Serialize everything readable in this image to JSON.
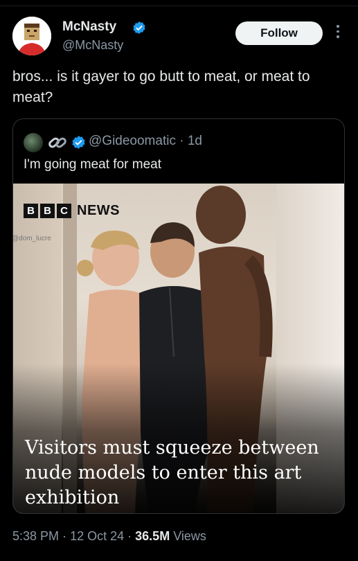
{
  "author": {
    "name": "McNasty",
    "handle": "@McNasty",
    "follow_label": "Follow",
    "verified_color": "#1d9bf0"
  },
  "tweet": {
    "text": "bros... is it gayer to go butt to meat, or meat to meat?"
  },
  "quote": {
    "handle": "@Gideoomatic",
    "time": "· 1d",
    "text": "I'm going meat for meat",
    "media": {
      "brand_letters": [
        "B",
        "B",
        "C"
      ],
      "brand_word": "NEWS",
      "watermark": "@dom_lucre",
      "caption": "Visitors must squeeze between nude models to enter this art exhibition"
    }
  },
  "meta": {
    "time": "5:38 PM",
    "date": "12 Oct 24",
    "views_count": "36.5M",
    "views_label": "Views"
  }
}
